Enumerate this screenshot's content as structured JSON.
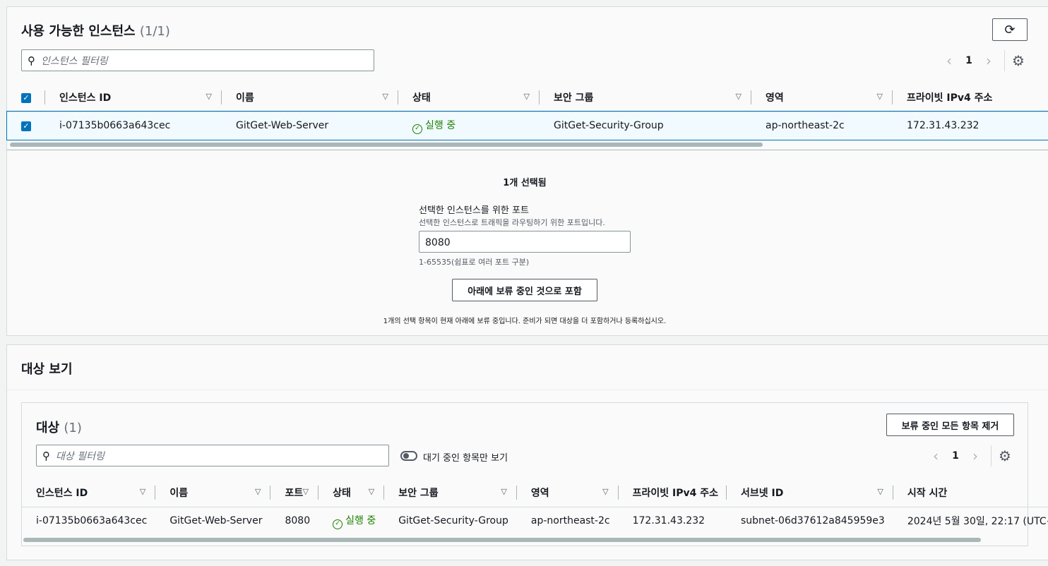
{
  "instances": {
    "title": "사용 가능한 인스턴스",
    "count": "(1/1)",
    "search_placeholder": "인스턴스 필터링",
    "page": "1",
    "columns": [
      "인스턴스 ID",
      "이름",
      "상태",
      "보안 그룹",
      "영역",
      "프라이빗 IPv4 주소"
    ],
    "rows": [
      {
        "id": "i-07135b0663a643cec",
        "name": "GitGet-Web-Server",
        "state": "실행 중",
        "sg": "GitGet-Security-Group",
        "zone": "ap-northeast-2c",
        "ip": "172.31.43.232"
      }
    ]
  },
  "selection": {
    "selected_text": "1개 선택됨",
    "port_label": "선택한 인스턴스를 위한 포트",
    "port_desc": "선택한 인스턴스로 트래픽을 라우팅하기 위한 포트입니다.",
    "port_value": "8080",
    "port_hint": "1-65535(쉼표로 여러 포트 구분)",
    "include_button": "아래에 보류 중인 것으로 포함",
    "pending_note": "1개의 선택 항목이 현재 아래에 보류 중입니다. 준비가 되면 대상을 더 포함하거나 등록하십시오."
  },
  "review": {
    "title": "대상 보기",
    "targets_title": "대상",
    "targets_count": "(1)",
    "remove_all_button": "보류 중인 모든 항목 제거",
    "search_placeholder": "대상 필터링",
    "toggle_label": "대기 중인 항목만 보기",
    "page": "1",
    "columns": [
      "인스턴스 ID",
      "이름",
      "포트",
      "상태",
      "보안 그룹",
      "영역",
      "프라이빗 IPv4 주소",
      "서브넷 ID",
      "시작 시간"
    ],
    "rows": [
      {
        "id": "i-07135b0663a643cec",
        "name": "GitGet-Web-Server",
        "port": "8080",
        "state": "실행 중",
        "sg": "GitGet-Security-Group",
        "zone": "ap-northeast-2c",
        "ip": "172.31.43.232",
        "subnet": "subnet-06d37612a845959e3",
        "launch": "2024년 5월 30일, 22:17 (UTC+"
      }
    ]
  },
  "colors": {
    "accent": "#0073bb",
    "running": "#1d8102"
  }
}
